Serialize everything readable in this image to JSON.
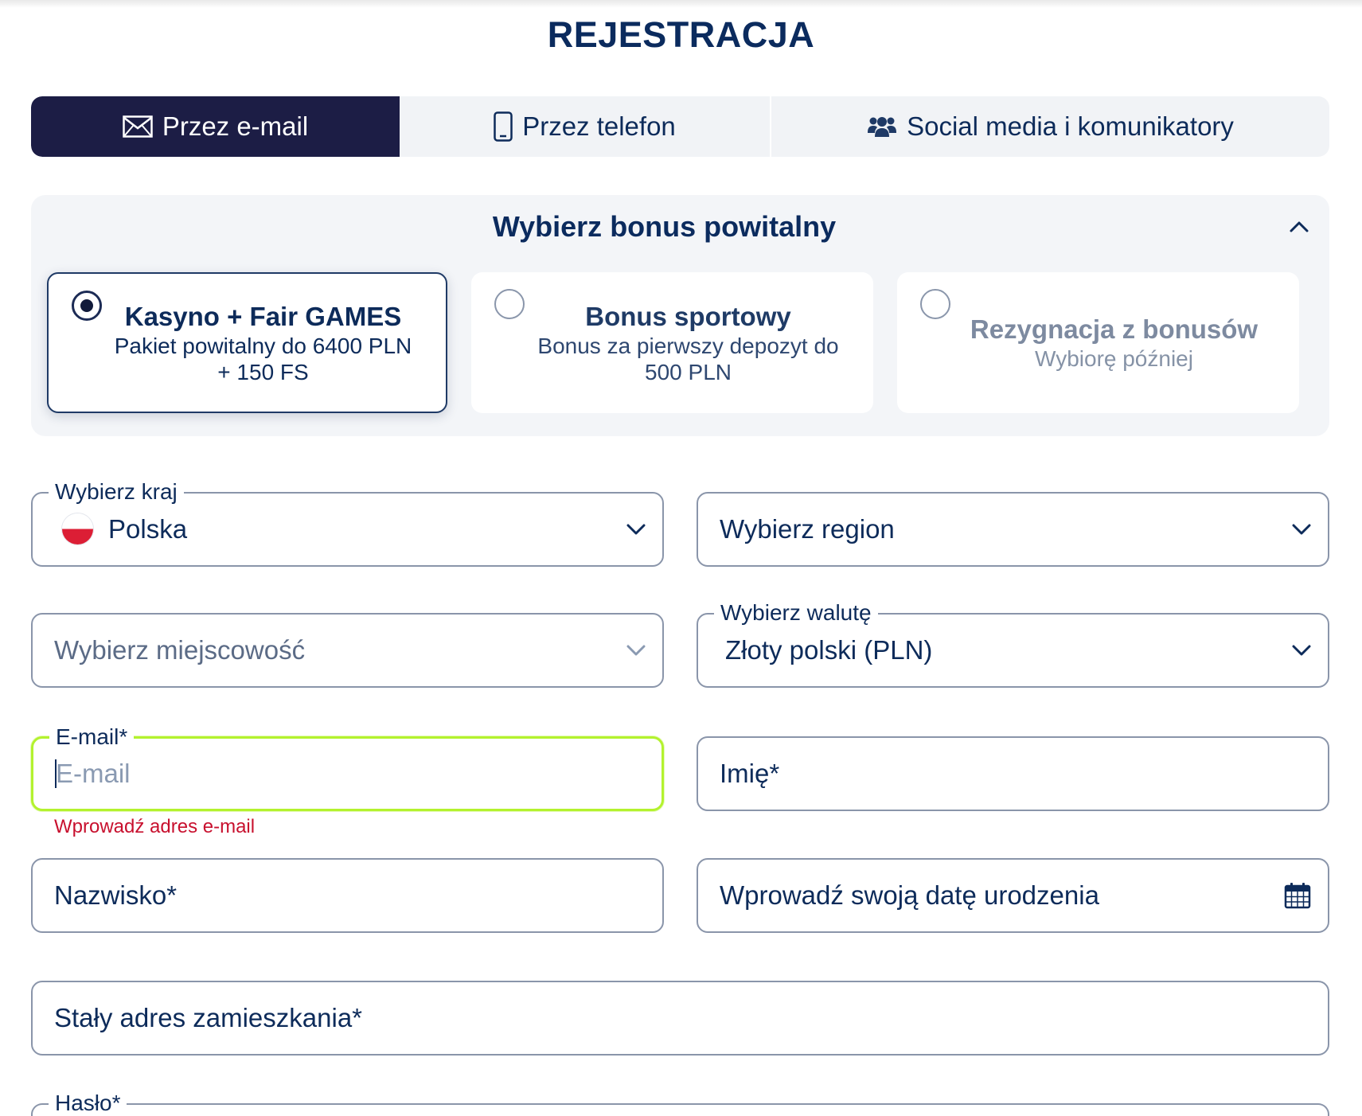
{
  "page": {
    "title": "REJESTRACJA"
  },
  "tabs": [
    {
      "label": "Przez e-mail",
      "icon": "envelope-icon",
      "active": true
    },
    {
      "label": "Przez telefon",
      "icon": "phone-icon",
      "active": false
    },
    {
      "label": "Social media i komunikatory",
      "icon": "users-icon",
      "active": false
    }
  ],
  "bonus": {
    "title": "Wybierz bonus powitalny",
    "collapse_icon": "chevron-up-icon",
    "cards": [
      {
        "title": "Kasyno + Fair GAMES",
        "subtitle_lines": [
          "Pakiet powitalny do 6400 PLN",
          "+ 150 FS"
        ],
        "selected": true
      },
      {
        "title": "Bonus sportowy",
        "subtitle_lines": [
          "Bonus za pierwszy depozyt do",
          "500 PLN"
        ],
        "selected": false
      },
      {
        "title": "Rezygnacja z bonusów",
        "subtitle_lines": [
          "Wybiorę później"
        ],
        "selected": false
      }
    ]
  },
  "form": {
    "country": {
      "label": "Wybierz kraj",
      "value": "Polska",
      "flag": "poland-flag-icon"
    },
    "region": {
      "placeholder": "Wybierz region"
    },
    "city": {
      "placeholder": "Wybierz miejscowość",
      "disabled": true
    },
    "currency": {
      "label": "Wybierz walutę",
      "value": "Złoty polski (PLN)"
    },
    "email": {
      "label": "E-mail*",
      "placeholder": "E-mail",
      "value": "",
      "error": "Wprowadź adres e-mail",
      "focused": true
    },
    "first_name": {
      "placeholder": "Imię*"
    },
    "last_name": {
      "placeholder": "Nazwisko*"
    },
    "birthdate": {
      "placeholder": "Wprowadź swoją datę urodzenia",
      "icon": "calendar-icon"
    },
    "address": {
      "placeholder": "Stały adres zamieszkania*"
    },
    "password": {
      "label": "Hasło*"
    }
  },
  "colors": {
    "active_tab_bg": "#1c1d45",
    "text_navy": "#0d2b5a",
    "focus_border": "#b3f22e",
    "error": "#c8102e",
    "flag_red": "#dc1e35"
  }
}
